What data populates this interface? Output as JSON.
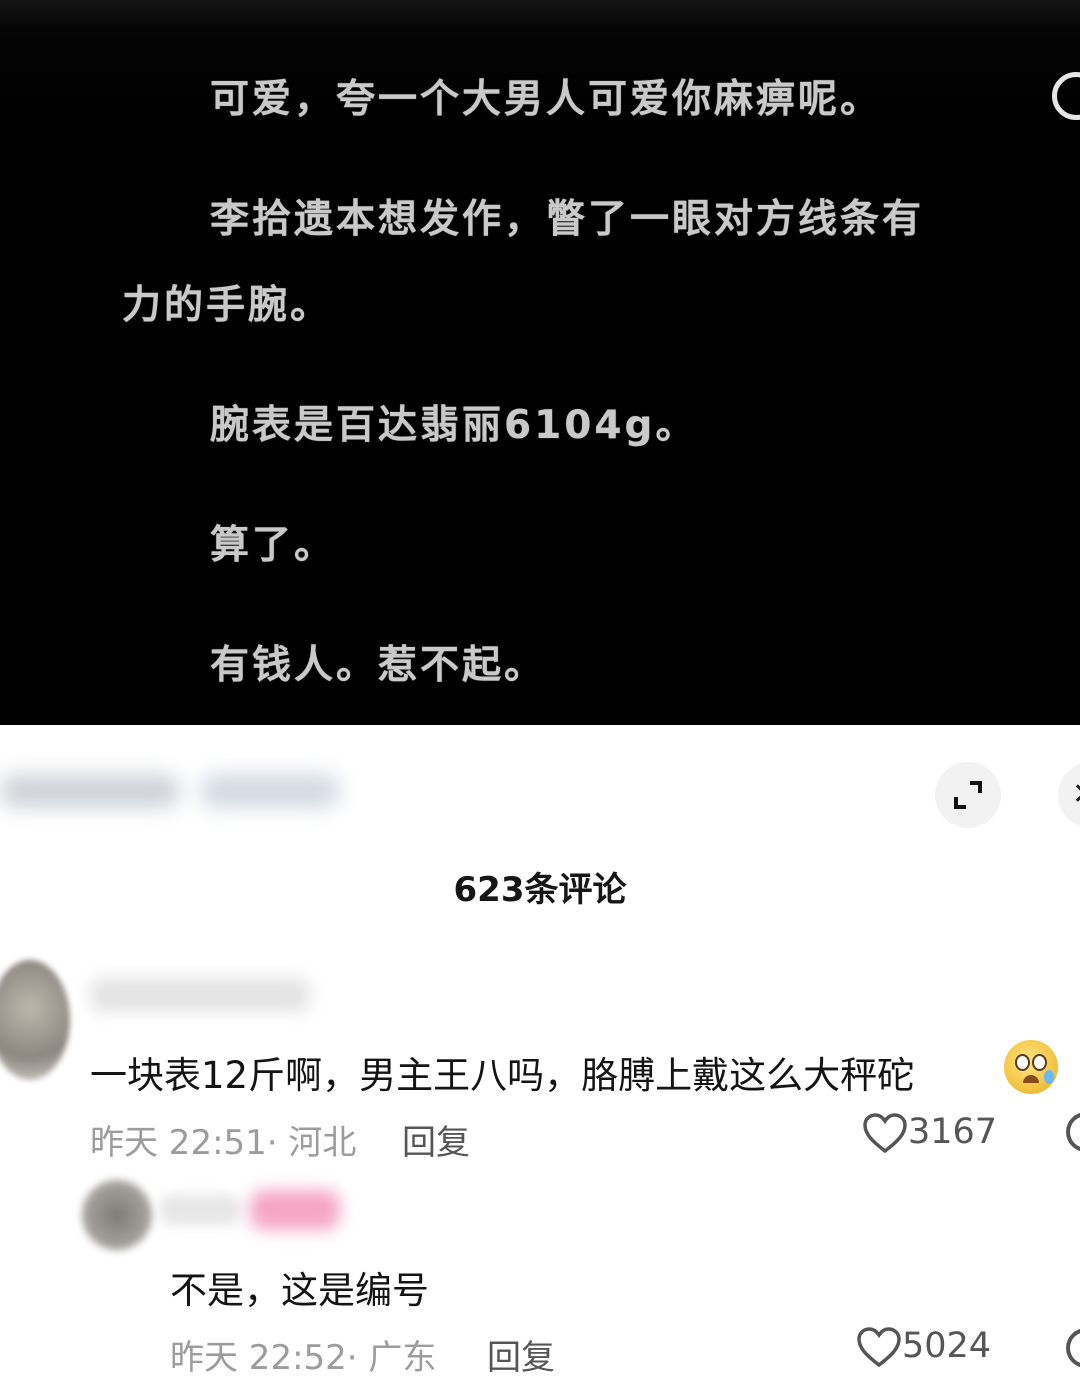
{
  "reader": {
    "paragraphs": [
      "可爱，夸一个大男人可爱你麻痹呢。",
      "李拾遗本想发作，瞥了一眼对方线条有",
      "力的手腕。",
      "腕表是百达翡丽6104g。",
      "算了。",
      "有钱人。惹不起。"
    ]
  },
  "comments_panel": {
    "count_label": "623条评论",
    "comments": [
      {
        "text": "一块表12斤啊，男主王八吗，胳膊上戴这么大秤砣",
        "emoji": "crying-laughing-emoji",
        "time": "昨天 22:51",
        "location": "· 河北",
        "reply_label": "回复",
        "likes": "3167"
      },
      {
        "text": "不是，这是编号",
        "time": "昨天 22:52",
        "location": "· 广东",
        "reply_label": "回复",
        "likes": "5024"
      }
    ]
  },
  "icons": {
    "expand": "expand-icon",
    "close": "close-icon",
    "heart": "heart-icon"
  }
}
